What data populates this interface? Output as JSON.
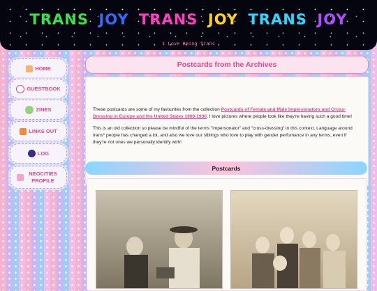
{
  "header": {
    "title_words": [
      "TRANS",
      "JOY",
      "TRANS",
      "JOY",
      "TRANS",
      "JOY"
    ],
    "subtitle": "I Love Being Trans"
  },
  "nav": {
    "items": [
      {
        "label": "HOME",
        "icon": "home-icon"
      },
      {
        "label": "GUESTBOOK",
        "icon": "guestbook-icon"
      },
      {
        "label": "ZINES",
        "icon": "zines-icon"
      },
      {
        "label": "LINKS OUT",
        "icon": "links-icon"
      },
      {
        "label": "LOG",
        "icon": "log-icon"
      },
      {
        "label": "NEOCITIES PROFILE",
        "icon": "neocities-icon"
      }
    ]
  },
  "page": {
    "title": "Postcards from the Archives",
    "intro_before": "These postcards are some of my favourites from the collection ",
    "intro_link": "Postcards of Female and Male Impersonators and Cross-Dressing in Europe and the United States 1900-1930",
    "intro_after": ". I love pictures where people look like they're having such a good time!",
    "intro_para2": "This is an old collection so please be mindful of the terms \"impersonator\" and \"cross-dressing\" in this context. Language around trans* people has changed a lot, and also we love our siblings who love to play with gender perfomance in any terms, even if they're not ones we personally identify with!",
    "section_title": "Postcards"
  },
  "colors": {
    "accent_pink": "#e44887",
    "header_bg": "#050510"
  }
}
